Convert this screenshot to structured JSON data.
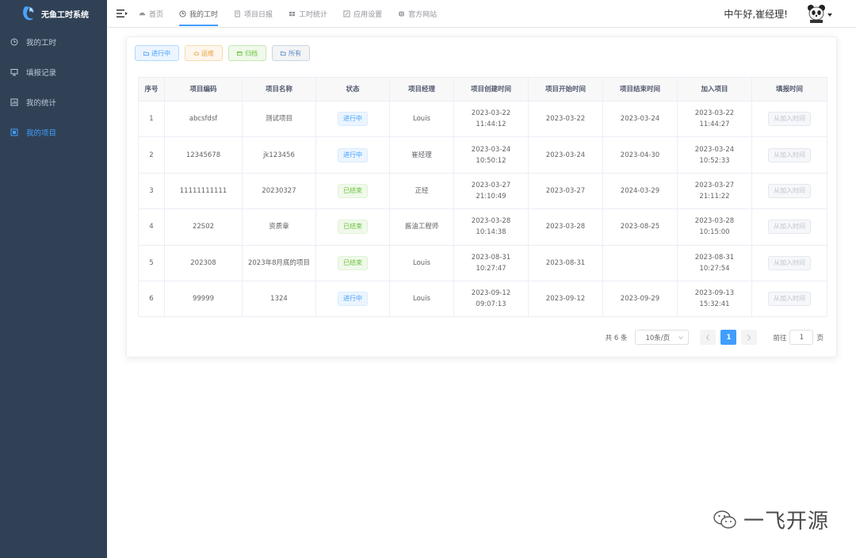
{
  "app": {
    "title": "无鱼工时系统"
  },
  "sidebar": {
    "items": [
      {
        "label": "我的工时",
        "icon": "clock-icon",
        "active": false
      },
      {
        "label": "填报记录",
        "icon": "monitor-icon",
        "active": false
      },
      {
        "label": "我的统计",
        "icon": "chart-icon",
        "active": false
      },
      {
        "label": "我的项目",
        "icon": "project-icon",
        "active": true
      }
    ]
  },
  "navbar": {
    "tabs": [
      {
        "label": "首页",
        "icon": "dashboard-icon",
        "active": false
      },
      {
        "label": "我的工时",
        "icon": "clock-icon",
        "active": true
      },
      {
        "label": "项目日报",
        "icon": "doc-icon",
        "active": false
      },
      {
        "label": "工时统计",
        "icon": "table-icon",
        "active": false
      },
      {
        "label": "应用设置",
        "icon": "settings-icon",
        "active": false
      },
      {
        "label": "官方网站",
        "icon": "globe-icon",
        "active": false
      }
    ],
    "greeting": "中午好,崔经理!"
  },
  "filters": [
    {
      "label": "进行中",
      "style": "blue",
      "icon": "folder-open-icon"
    },
    {
      "label": "运维",
      "style": "yellow",
      "icon": "cloud-icon"
    },
    {
      "label": "归档",
      "style": "green",
      "icon": "archive-icon"
    },
    {
      "label": "所有",
      "style": "gray",
      "icon": "folder-icon"
    }
  ],
  "table": {
    "headers": [
      "序号",
      "项目编码",
      "项目名称",
      "状态",
      "项目经理",
      "项目创建时间",
      "项目开始时间",
      "项目结束时间",
      "加入项目",
      "填报时间"
    ],
    "rows": [
      {
        "no": "1",
        "code": "abcsfdsf",
        "name": "测试项目",
        "status": "进行中",
        "status_type": "running",
        "manager": "Louis",
        "created": "2023-03-22 11:44:12",
        "start": "2023-03-22",
        "end": "2023-03-24",
        "joined": "2023-03-22 11:44:27",
        "action": "从加入时间"
      },
      {
        "no": "2",
        "code": "12345678",
        "name": "jk123456",
        "status": "进行中",
        "status_type": "running",
        "manager": "崔经理",
        "created": "2023-03-24 10:50:12",
        "start": "2023-03-24",
        "end": "2023-04-30",
        "joined": "2023-03-24 10:52:33",
        "action": "从加入时间"
      },
      {
        "no": "3",
        "code": "11111111111",
        "name": "20230327",
        "status": "已结束",
        "status_type": "ended",
        "manager": "正经",
        "created": "2023-03-27 21:10:49",
        "start": "2023-03-27",
        "end": "2024-03-29",
        "joined": "2023-03-27 21:11:22",
        "action": "从加入时间"
      },
      {
        "no": "4",
        "code": "22S02",
        "name": "资质章",
        "status": "已结束",
        "status_type": "ended",
        "manager": "酱油工程师",
        "created": "2023-03-28 10:14:38",
        "start": "2023-03-28",
        "end": "2023-08-25",
        "joined": "2023-03-28 10:15:00",
        "action": "从加入时间"
      },
      {
        "no": "5",
        "code": "202308",
        "name": "2023年8月底的项目",
        "status": "已结束",
        "status_type": "ended",
        "manager": "Louis",
        "created": "2023-08-31 10:27:47",
        "start": "2023-08-31",
        "end": "",
        "joined": "2023-08-31 10:27:54",
        "action": "从加入时间"
      },
      {
        "no": "6",
        "code": "99999",
        "name": "1324",
        "status": "进行中",
        "status_type": "running",
        "manager": "Louis",
        "created": "2023-09-12 09:07:13",
        "start": "2023-09-12",
        "end": "2023-09-29",
        "joined": "2023-09-13 15:32:41",
        "action": "从加入时间"
      }
    ]
  },
  "pagination": {
    "total": "共 6 条",
    "page_size": "10条/页",
    "current_page": "1",
    "goto_label": "前往",
    "goto_value": "1",
    "page_suffix": "页"
  },
  "watermark": {
    "text": "一飞开源"
  },
  "colors": {
    "sidebar_bg": "#304156",
    "accent": "#409eff",
    "success": "#67c23a",
    "warning": "#e6a23c"
  }
}
